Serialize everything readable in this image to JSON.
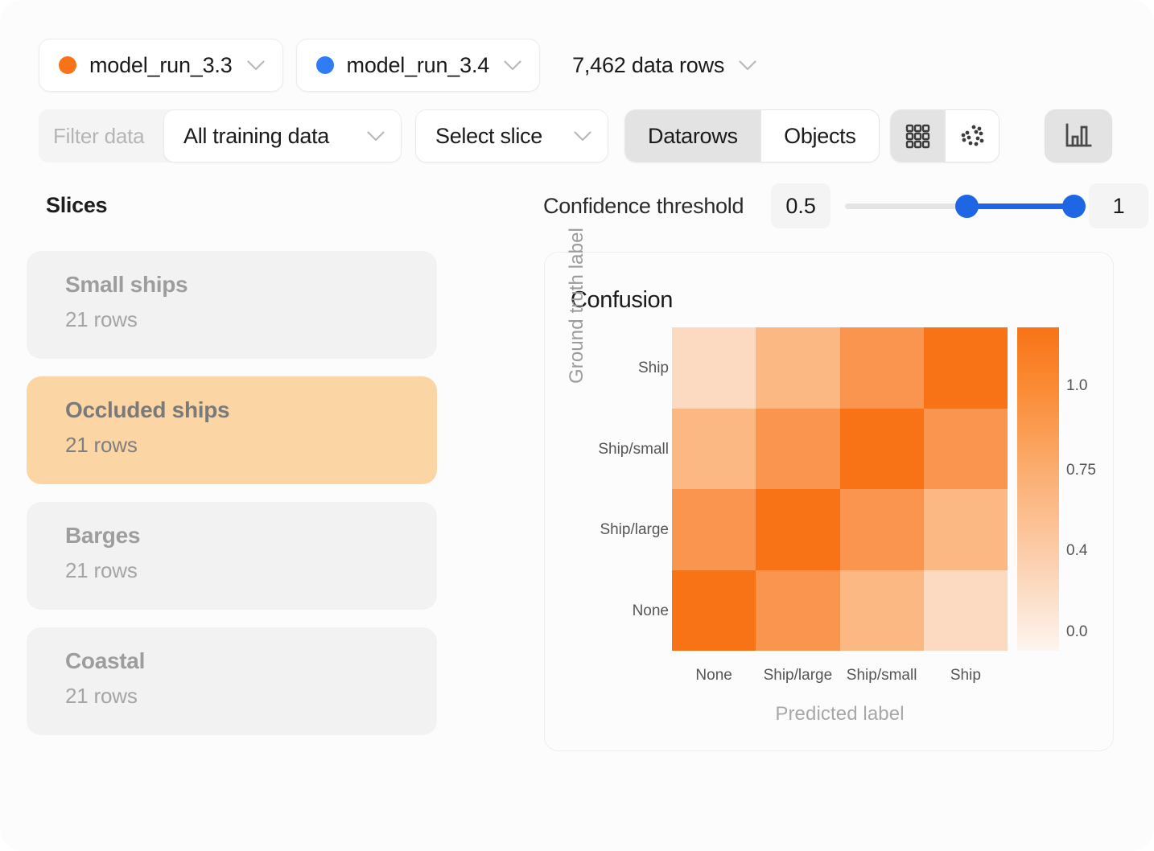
{
  "header": {
    "runs": [
      {
        "label": "model_run_3.3",
        "dot_color": "#f97316",
        "chevron": "chevron-down-icon"
      },
      {
        "label": "model_run_3.4",
        "dot_color": "#2f7cf6",
        "chevron": "chevron-down-icon"
      }
    ],
    "data_rows": "7,462 data rows"
  },
  "filters": {
    "filter_placeholder": "Filter data",
    "filter_value": "",
    "training_dropdown": "All training data",
    "slice_dropdown": "Select slice",
    "segmented": {
      "options": [
        "Datarows",
        "Objects"
      ],
      "selected": "Datarows"
    },
    "view_icons": {
      "options": [
        "grid-view-icon",
        "scatter-view-icon"
      ],
      "selected": "grid-view-icon"
    },
    "chart_toggle": {
      "icon": "bar-chart-icon",
      "active": true
    }
  },
  "sidebar": {
    "title": "Slices",
    "items": [
      {
        "name": "Small ships",
        "rows": "21 rows",
        "selected": false
      },
      {
        "name": "Occluded ships",
        "rows": "21 rows",
        "selected": true
      },
      {
        "name": "Barges",
        "rows": "21 rows",
        "selected": false
      },
      {
        "name": "Coastal",
        "rows": "21 rows",
        "selected": false
      }
    ]
  },
  "confidence": {
    "label": "Confidence threshold",
    "min_value": "0.5",
    "max_value": "1"
  },
  "chart_data": {
    "type": "heatmap",
    "title": "Confusion",
    "xlabel": "Predicted label",
    "ylabel": "Ground truth label",
    "x_categories": [
      "None",
      "Ship/large",
      "Ship/small",
      "Ship"
    ],
    "y_categories": [
      "Ship",
      "Ship/small",
      "Ship/large",
      "None"
    ],
    "values": [
      [
        0.15,
        0.5,
        0.7,
        1.0
      ],
      [
        0.5,
        0.7,
        1.0,
        0.7
      ],
      [
        0.7,
        1.0,
        0.7,
        0.5
      ],
      [
        1.0,
        0.7,
        0.5,
        0.15
      ]
    ],
    "colors": [
      [
        "#fbdac1",
        "#fbb882",
        "#f9954f",
        "#f87316"
      ],
      [
        "#fbb882",
        "#f9954f",
        "#f87316",
        "#f9954f"
      ],
      [
        "#f9954f",
        "#f87316",
        "#f9954f",
        "#fbb882"
      ],
      [
        "#f87316",
        "#f9954f",
        "#fbb882",
        "#fbdac1"
      ]
    ],
    "colorbar": {
      "ticks": [
        "1.0",
        "0.75",
        "0.4",
        "0.0"
      ],
      "tick_positions": [
        0.18,
        0.44,
        0.69,
        0.94
      ],
      "low_color": "#fdf5ef",
      "high_color": "#f87316"
    },
    "grid": false,
    "legend_position": "right"
  }
}
